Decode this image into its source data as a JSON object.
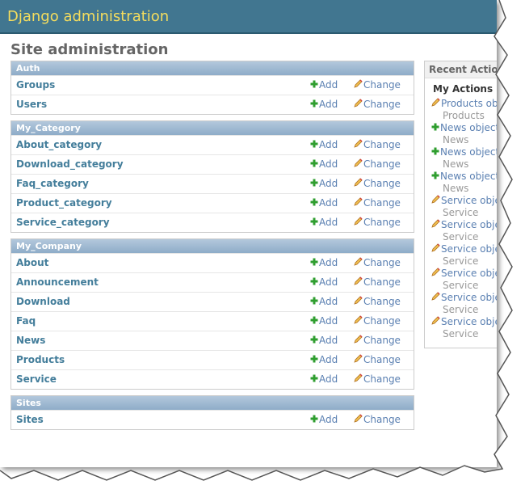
{
  "header": {
    "site_name": "Django administration"
  },
  "page": {
    "title": "Site administration"
  },
  "colors": {
    "header_bg": "#417690",
    "site_name": "#f5dd5d",
    "link": "#447e9b",
    "add": "#2f9e2f"
  },
  "modules": [
    {
      "name": "Auth",
      "models": [
        {
          "name": "Groups",
          "add": "Add",
          "change": "Change"
        },
        {
          "name": "Users",
          "add": "Add",
          "change": "Change"
        }
      ]
    },
    {
      "name": "My_Category",
      "models": [
        {
          "name": "About_category",
          "add": "Add",
          "change": "Change"
        },
        {
          "name": "Download_category",
          "add": "Add",
          "change": "Change"
        },
        {
          "name": "Faq_category",
          "add": "Add",
          "change": "Change"
        },
        {
          "name": "Product_category",
          "add": "Add",
          "change": "Change"
        },
        {
          "name": "Service_category",
          "add": "Add",
          "change": "Change"
        }
      ]
    },
    {
      "name": "My_Company",
      "models": [
        {
          "name": "About",
          "add": "Add",
          "change": "Change"
        },
        {
          "name": "Announcement",
          "add": "Add",
          "change": "Change"
        },
        {
          "name": "Download",
          "add": "Add",
          "change": "Change"
        },
        {
          "name": "Faq",
          "add": "Add",
          "change": "Change"
        },
        {
          "name": "News",
          "add": "Add",
          "change": "Change"
        },
        {
          "name": "Products",
          "add": "Add",
          "change": "Change"
        },
        {
          "name": "Service",
          "add": "Add",
          "change": "Change"
        }
      ]
    },
    {
      "name": "Sites",
      "models": [
        {
          "name": "Sites",
          "add": "Add",
          "change": "Change"
        }
      ]
    }
  ],
  "recent_actions": {
    "title": "Recent Actions",
    "my_actions_title": "My Actions",
    "items": [
      {
        "icon": "pencil-icon",
        "label": "Products object",
        "type": "Products"
      },
      {
        "icon": "plus-icon",
        "label": "News object",
        "type": "News"
      },
      {
        "icon": "plus-icon",
        "label": "News object",
        "type": "News"
      },
      {
        "icon": "plus-icon",
        "label": "News object",
        "type": "News"
      },
      {
        "icon": "pencil-icon",
        "label": "Service object",
        "type": "Service"
      },
      {
        "icon": "pencil-icon",
        "label": "Service object",
        "type": "Service"
      },
      {
        "icon": "pencil-icon",
        "label": "Service object",
        "type": "Service"
      },
      {
        "icon": "pencil-icon",
        "label": "Service object",
        "type": "Service"
      },
      {
        "icon": "pencil-icon",
        "label": "Service object",
        "type": "Service"
      },
      {
        "icon": "pencil-icon",
        "label": "Service object",
        "type": "Service"
      }
    ]
  }
}
